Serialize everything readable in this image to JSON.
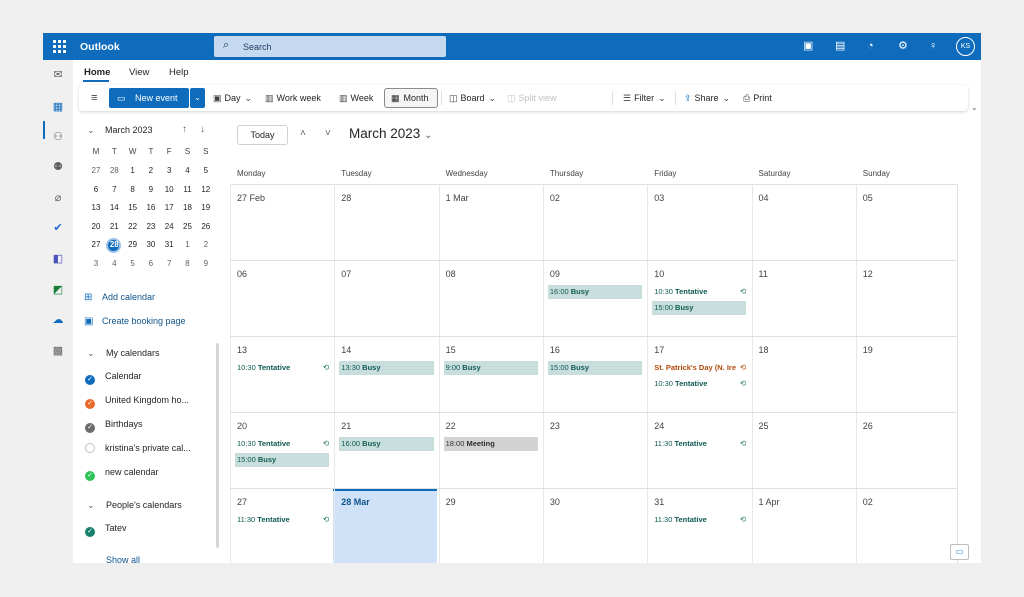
{
  "app": {
    "title": "Outlook",
    "search_placeholder": "Search",
    "user_initials": "KS"
  },
  "ribbon": {
    "tabs": [
      "Home",
      "View",
      "Help"
    ]
  },
  "toolbar": {
    "new_event": "New event",
    "day": "Day",
    "work_week": "Work week",
    "week": "Week",
    "month": "Month",
    "board": "Board",
    "split_view": "Split view",
    "filter": "Filter",
    "share": "Share",
    "print": "Print"
  },
  "mini_calendar": {
    "title": "March 2023",
    "weekdays": [
      "M",
      "T",
      "W",
      "T",
      "F",
      "S",
      "S"
    ],
    "weeks": [
      [
        "27",
        "28",
        "1",
        "2",
        "3",
        "4",
        "5"
      ],
      [
        "6",
        "7",
        "8",
        "9",
        "10",
        "11",
        "12"
      ],
      [
        "13",
        "14",
        "15",
        "16",
        "17",
        "18",
        "19"
      ],
      [
        "20",
        "21",
        "22",
        "23",
        "24",
        "25",
        "26"
      ],
      [
        "27",
        "28",
        "29",
        "30",
        "31",
        "1",
        "2"
      ],
      [
        "3",
        "4",
        "5",
        "6",
        "7",
        "8",
        "9"
      ]
    ],
    "selected": "28"
  },
  "sidebar": {
    "add_calendar": "Add calendar",
    "create_booking": "Create booking page",
    "my_calendars": "My calendars",
    "calendars": [
      {
        "name": "Calendar",
        "color": "#0f6cbd"
      },
      {
        "name": "United Kingdom ho...",
        "color": "#e8692a"
      },
      {
        "name": "Birthdays",
        "color": "#6b6b6b"
      },
      {
        "name": "kristina's private cal...",
        "color": "#ffffff"
      },
      {
        "name": "new calendar",
        "color": "#2ec45a"
      }
    ],
    "peoples_calendars": "People's calendars",
    "people": [
      {
        "name": "Tatev",
        "color": "#17806d"
      }
    ],
    "show_all": "Show all"
  },
  "calendar": {
    "today_button": "Today",
    "title": "March 2023",
    "weekdays": [
      "Monday",
      "Tuesday",
      "Wednesday",
      "Thursday",
      "Friday",
      "Saturday",
      "Sunday"
    ],
    "weeks": [
      [
        "27 Feb",
        "28",
        "1 Mar",
        "02",
        "03",
        "04",
        "05"
      ],
      [
        "06",
        "07",
        "08",
        "09",
        "10",
        "11",
        "12"
      ],
      [
        "13",
        "14",
        "15",
        "16",
        "17",
        "18",
        "19"
      ],
      [
        "20",
        "21",
        "22",
        "23",
        "24",
        "25",
        "26"
      ],
      [
        "27",
        "28 Mar",
        "29",
        "30",
        "31",
        "1 Apr",
        "02"
      ]
    ],
    "events": [
      {
        "week": 1,
        "day": 3,
        "row": 0,
        "time": "16:00",
        "title": "Busy",
        "style": "busy"
      },
      {
        "week": 1,
        "day": 4,
        "row": 0,
        "time": "10:30",
        "title": "Tentative",
        "style": "tentative",
        "recurring": true
      },
      {
        "week": 1,
        "day": 4,
        "row": 1,
        "time": "15:00",
        "title": "Busy",
        "style": "busy"
      },
      {
        "week": 2,
        "day": 0,
        "row": 0,
        "time": "10:30",
        "title": "Tentative",
        "style": "tentative",
        "recurring": true
      },
      {
        "week": 2,
        "day": 1,
        "row": 0,
        "time": "13:30",
        "title": "Busy",
        "style": "busy"
      },
      {
        "week": 2,
        "day": 2,
        "row": 0,
        "time": "9:00",
        "title": "Busy",
        "style": "busy"
      },
      {
        "week": 2,
        "day": 3,
        "row": 0,
        "time": "15:00",
        "title": "Busy",
        "style": "busy"
      },
      {
        "week": 2,
        "day": 4,
        "row": 0,
        "time": "",
        "title": "St. Patrick's Day (N. Ire",
        "style": "holiday",
        "recurring": true
      },
      {
        "week": 2,
        "day": 4,
        "row": 1,
        "time": "10:30",
        "title": "Tentative",
        "style": "tentative",
        "recurring": true
      },
      {
        "week": 3,
        "day": 0,
        "row": 0,
        "time": "10:30",
        "title": "Tentative",
        "style": "tentative",
        "recurring": true
      },
      {
        "week": 3,
        "day": 0,
        "row": 1,
        "time": "15:00",
        "title": "Busy",
        "style": "busy"
      },
      {
        "week": 3,
        "day": 1,
        "row": 0,
        "time": "16:00",
        "title": "Busy",
        "style": "busy"
      },
      {
        "week": 3,
        "day": 2,
        "row": 0,
        "time": "18:00",
        "title": "Meeting",
        "style": "meeting"
      },
      {
        "week": 3,
        "day": 4,
        "row": 0,
        "time": "11:30",
        "title": "Tentative",
        "style": "tentative",
        "recurring": true
      },
      {
        "week": 4,
        "day": 0,
        "row": 0,
        "time": "11:30",
        "title": "Tentative",
        "style": "tentative",
        "recurring": true
      },
      {
        "week": 4,
        "day": 4,
        "row": 0,
        "time": "11:30",
        "title": "Tentative",
        "style": "tentative",
        "recurring": true
      }
    ]
  }
}
